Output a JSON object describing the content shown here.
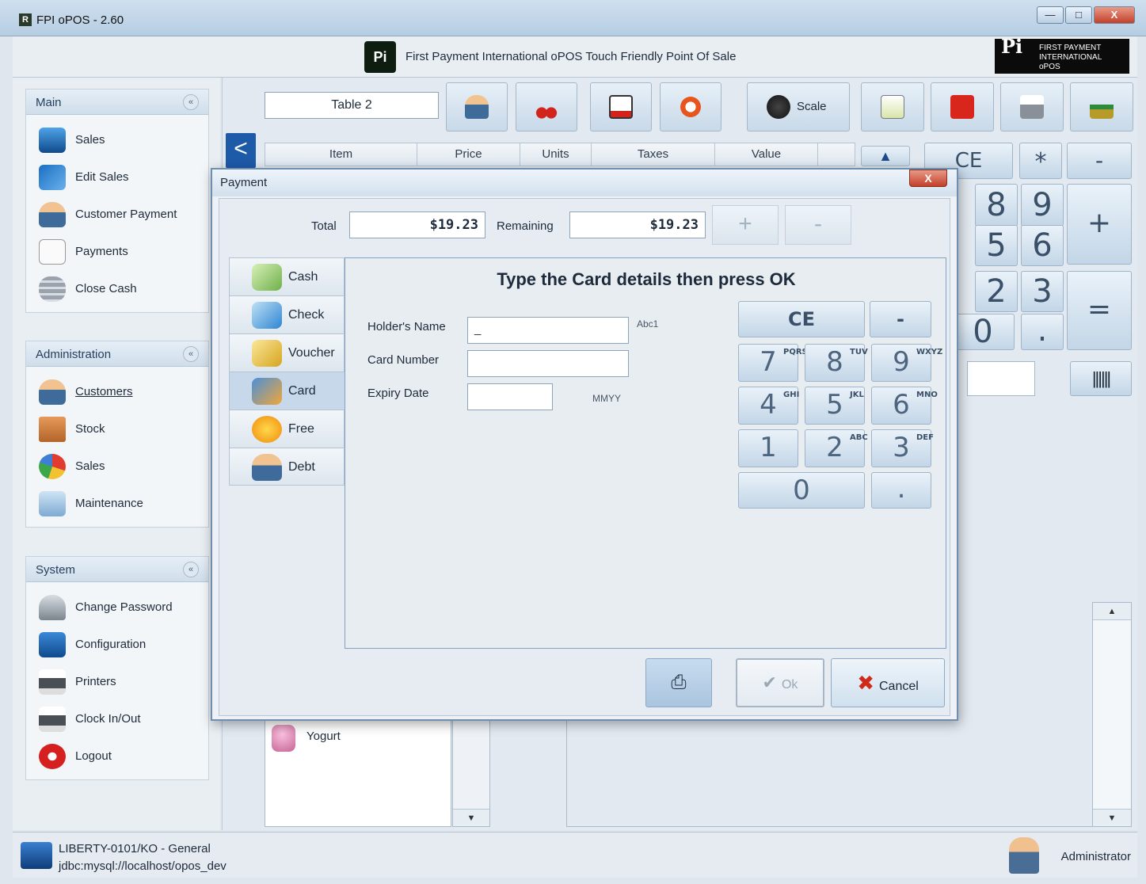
{
  "window": {
    "title": "FPI oPOS - 2.60",
    "app_icon_letter": "R",
    "min_glyph": "—",
    "max_glyph": "□",
    "close_glyph": "X"
  },
  "header": {
    "logo_text": "Pi",
    "tagline": "First Payment International oPOS   Touch Friendly Point Of Sale",
    "brand_pi": "Pi",
    "brand_text": "FIRST PAYMENT INTERNATIONAL oPOS"
  },
  "sidebar": {
    "collapse_glyph": "«",
    "main": {
      "title": "Main",
      "items": [
        "Sales",
        "Edit Sales",
        "Customer Payment",
        "Payments",
        "Close Cash"
      ]
    },
    "administration": {
      "title": "Administration",
      "items": [
        "Customers",
        "Stock",
        "Sales",
        "Maintenance"
      ]
    },
    "system": {
      "title": "System",
      "items": [
        "Change Password",
        "Configuration",
        "Printers",
        "Clock In/Out",
        "Logout"
      ]
    }
  },
  "sales": {
    "table_name": "Table 2",
    "scale_label": "Scale",
    "back_glyph": "<",
    "up_glyph": "▲",
    "columns": [
      "Item",
      "Price",
      "Units",
      "Taxes",
      "Value"
    ],
    "keypad": {
      "ce": "CE",
      "multiply": "*",
      "minus": "-",
      "plus": "+",
      "equals": "=",
      "digits": [
        "8",
        "9",
        "5",
        "6",
        "2",
        "3",
        "0",
        "."
      ]
    },
    "barcode_glyph": "||||||",
    "product": "Yogurt",
    "scroll_up": "▲",
    "scroll_down": "▼"
  },
  "payment": {
    "title": "Payment",
    "close_glyph": "X",
    "total_label": "Total",
    "total_value": "$19.23",
    "remaining_label": "Remaining",
    "remaining_value": "$19.23",
    "add_glyph": "+",
    "remove_glyph": "-",
    "tabs": [
      "Cash",
      "Check",
      "Voucher",
      "Card",
      "Free",
      "Debt"
    ],
    "active_tab": "Card",
    "card": {
      "heading": "Type the Card details then press OK",
      "holder_label": "Holder's Name",
      "holder_value": "_",
      "holder_hint": "Abc1",
      "number_label": "Card Number",
      "number_value": "",
      "expiry_label": "Expiry Date",
      "expiry_value": "",
      "expiry_hint": "MMYY"
    },
    "keypad": {
      "ce": "CE",
      "minus": "-",
      "keys": [
        {
          "digit": "7",
          "letters": "PQRS"
        },
        {
          "digit": "8",
          "letters": "TUV"
        },
        {
          "digit": "9",
          "letters": "WXYZ"
        },
        {
          "digit": "4",
          "letters": "GHI"
        },
        {
          "digit": "5",
          "letters": "JKL"
        },
        {
          "digit": "6",
          "letters": "MNO"
        },
        {
          "digit": "1",
          "letters": ""
        },
        {
          "digit": "2",
          "letters": "ABC"
        },
        {
          "digit": "3",
          "letters": "DEF"
        }
      ],
      "zero": "0",
      "dot": "."
    },
    "print_glyph": "⎙",
    "ok_label": "Ok",
    "ok_glyph": "✔",
    "cancel_label": "Cancel",
    "cancel_glyph": "✖"
  },
  "status": {
    "host": "LIBERTY-0101/KO - General",
    "db_url": "jdbc:mysql://localhost/opos_dev",
    "user": "Administrator"
  },
  "colors": {
    "accent_blue": "#1d5aa8",
    "danger_red": "#d02a1a",
    "panel_border": "#7fa2c5"
  }
}
